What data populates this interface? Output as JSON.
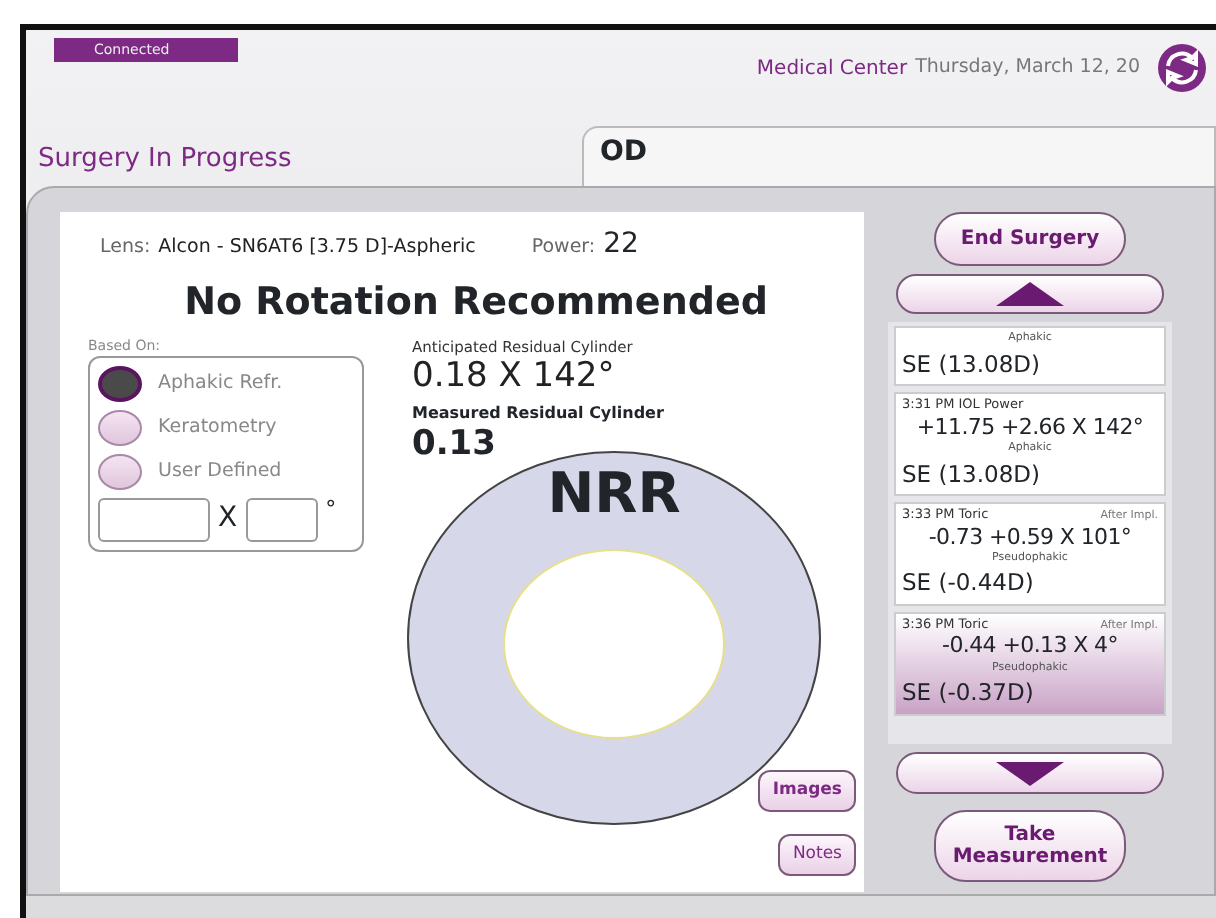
{
  "header": {
    "status": "Connected",
    "facility": "Medical Center",
    "date": "Thursday, March 12, 20"
  },
  "title": "Surgery In Progress",
  "eye_tab": {
    "label": "OD"
  },
  "lens": {
    "label": "Lens:",
    "value": "Alcon - SN6AT6 [3.75 D]-Aspheric",
    "power_label": "Power:",
    "power": "22"
  },
  "headline": "No Rotation Recommended",
  "based_on": {
    "label": "Based On:",
    "options": [
      {
        "label": "Aphakic Refr.",
        "selected": true
      },
      {
        "label": "Keratometry",
        "selected": false
      },
      {
        "label": "User Defined",
        "selected": false
      }
    ],
    "x_label": "X",
    "degree": "°"
  },
  "anticipated": {
    "label": "Anticipated Residual Cylinder",
    "value": "0.18 X 142°"
  },
  "measured": {
    "label": "Measured Residual Cylinder",
    "value": "0.13"
  },
  "diagram": {
    "label": "NRR"
  },
  "card_buttons": [
    {
      "label": "Images",
      "bold": true
    },
    {
      "label": "Notes",
      "bold": false
    }
  ],
  "end_button": "End Surgery",
  "measurements": [
    {
      "lens_state": "Aphakic",
      "se": "SE (13.08D)",
      "selected": false
    },
    {
      "time": "3:31 PM IOL Power",
      "values": "+11.75 +2.66 X 142°",
      "lens_state": "Aphakic",
      "se": "SE (13.08D)",
      "selected": false
    },
    {
      "time": "3:33 PM Toric",
      "note": "After Impl.",
      "values": "-0.73 +0.59 X 101°",
      "lens_state": "Pseudophakic",
      "se": "SE (-0.44D)",
      "selected": false
    },
    {
      "time": "3:36 PM Toric",
      "note": "After Impl.",
      "values": "-0.44 +0.13 X 4°",
      "lens_state": "Pseudophakic",
      "se": "SE (-0.37D)",
      "selected": true
    }
  ],
  "take_button": "Take Measurement"
}
